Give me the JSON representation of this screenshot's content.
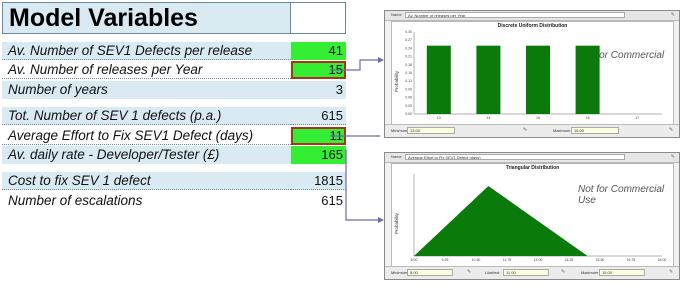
{
  "sheet": {
    "title": "Model Variables",
    "rows": [
      {
        "label": "Av. Number of SEV1 Defects per release",
        "value": "41"
      },
      {
        "label": "Av. Number of releases per Year",
        "value": "15"
      },
      {
        "label": "Number of years",
        "value": "3"
      },
      {
        "label": "Tot. Number of SEV 1 defects (p.a.)",
        "value": "615"
      },
      {
        "label": "Average Effort to Fix SEV1 Defect (days)",
        "value": "11"
      },
      {
        "label": "Av. daily rate - Developer/Tester (£)",
        "value": "165"
      },
      {
        "label": "Cost to fix SEV 1 defect",
        "value": "1815"
      },
      {
        "label": "Number of escalations",
        "value": "615"
      }
    ]
  },
  "colors": {
    "input_green": "#33ee33",
    "row_blue": "#d9eaf2",
    "highlight_red": "#b03020",
    "chart_green": "#0a7a0a"
  },
  "discrete_window": {
    "name_label": "Name",
    "name_value": "Av. Number of releases per Year",
    "title": "Discrete Uniform Distribution",
    "watermark": "Not for Commercial Use",
    "y_axis_label": "Probability",
    "y_ticks": [
      "0.30",
      "0.27",
      "0.24",
      "0.21",
      "0.18",
      "0.15",
      "0.12",
      "0.09",
      "0.06",
      "0.03",
      "0.00"
    ],
    "x_ticks": [
      "13",
      "14",
      "15",
      "16",
      "17"
    ],
    "min_label": "Minimum",
    "min_value": "13.00",
    "max_label": "Maximum",
    "max_value": "16.00"
  },
  "triangular_window": {
    "name_label": "Name",
    "name_value": "Average Effort to Fix SEV1 Defect (days)",
    "title": "Triangular Distribution",
    "watermark": "Not for Commercial Use",
    "y_axis_label": "Probability",
    "x_ticks": [
      "8.00",
      "9.25",
      "10.50",
      "11.75",
      "13.00",
      "14.25",
      "15.50",
      "16.75",
      "18.00"
    ],
    "min_label": "Minimum",
    "min_value": "8.00",
    "likeliest_label": "Likeliest",
    "likeliest_value": "11.00",
    "max_label": "Maximum",
    "max_value": "15.00"
  },
  "chart_data": [
    {
      "type": "bar",
      "title": "Discrete Uniform Distribution",
      "ylabel": "Probability",
      "categories": [
        "13",
        "14",
        "15",
        "16"
      ],
      "values": [
        0.25,
        0.25,
        0.25,
        0.25
      ],
      "ylim": [
        0,
        0.3
      ]
    },
    {
      "type": "area",
      "title": "Triangular Distribution",
      "ylabel": "Probability",
      "x": [
        8.0,
        11.0,
        15.0
      ],
      "y": [
        0,
        1,
        0
      ],
      "xlim": [
        8.0,
        18.0
      ]
    }
  ]
}
